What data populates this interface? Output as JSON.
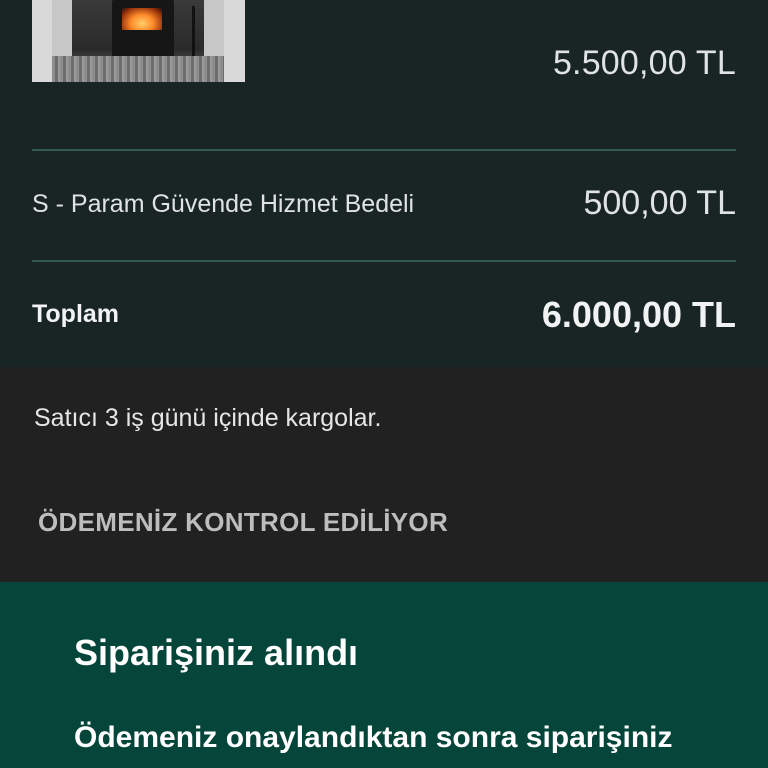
{
  "order": {
    "item_price": "5.500,00 TL",
    "fee_label": "S - Param Güvende Hizmet Bedeli",
    "fee_value": "500,00 TL",
    "total_label": "Toplam",
    "total_value": "6.000,00 TL"
  },
  "shipping_note": "Satıcı 3 iş günü içinde kargolar.",
  "payment_status": "ÖDEMENİZ KONTROL EDİLİYOR",
  "confirmation": {
    "title": "Siparişiniz alındı",
    "text": "Ödemeniz onaylandıktan sonra siparişiniz"
  },
  "colors": {
    "summary_bg": "#182524",
    "page_bg": "#212121",
    "confirm_bg": "#06463a",
    "divider": "#2f5a4c"
  }
}
